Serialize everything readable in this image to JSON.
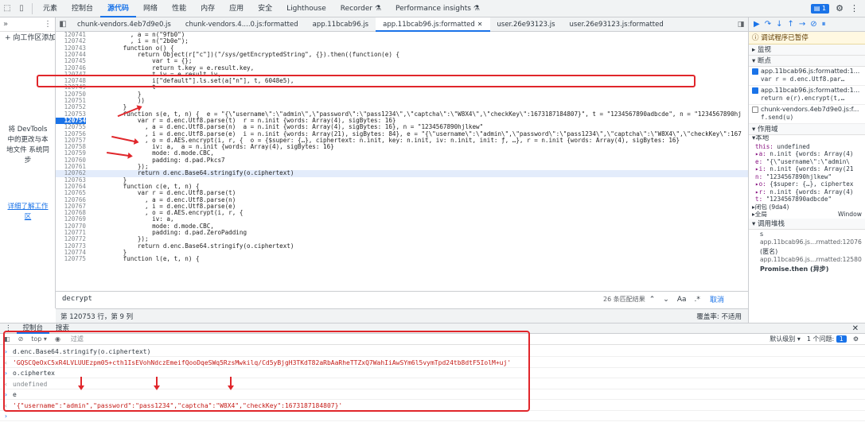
{
  "topbar": {
    "tabs": [
      "元素",
      "控制台",
      "源代码",
      "网络",
      "性能",
      "内存",
      "应用",
      "安全",
      "Lighthouse",
      "Recorder ⚗",
      "Performance insights ⚗"
    ],
    "active_index": 2,
    "issues_badge": "1"
  },
  "navigator": {
    "add_workspace": "+ 向工作区添加",
    "drop_message": "将 DevTools 中的更改与本地文件 系统同步",
    "learn_more": "详细了解工作区"
  },
  "file_tabs": [
    {
      "label": "chunk-vendors.4eb7d9e0.js",
      "active": false
    },
    {
      "label": "chunk-vendors.4....0.js:formatted",
      "active": false
    },
    {
      "label": "app.11bcab96.js",
      "active": false
    },
    {
      "label": "app.11bcab96.js:formatted",
      "active": true
    },
    {
      "label": "user.26e93123.js",
      "active": false
    },
    {
      "label": "user.26e93123.js:formatted",
      "active": false
    }
  ],
  "code": {
    "lines": [
      {
        "n": "120741",
        "t": "          , a = n(\"9fb0\")"
      },
      {
        "n": "120742",
        "t": "          , i = n(\"2b0e\");"
      },
      {
        "n": "120743",
        "t": "        function o() {"
      },
      {
        "n": "120744",
        "t": "            return Object(r[\"c\"])(\"/sys/getEncryptedString\", {}).then((function(e) {"
      },
      {
        "n": "120745",
        "t": "                var t = {};"
      },
      {
        "n": "120746",
        "t": "                return t.key = e.result.key,"
      },
      {
        "n": "120747",
        "t": "                t.iv = e.result.iv,"
      },
      {
        "n": "120748",
        "t": "                i[\"default\"].ls.set(a[\"n\"], t, 6048e5),"
      },
      {
        "n": "120749",
        "t": "                t"
      },
      {
        "n": "120750",
        "t": "            }"
      },
      {
        "n": "120751",
        "t": "            ))"
      },
      {
        "n": "120752",
        "t": "        }"
      },
      {
        "n": "120753",
        "t": "        function s(e, t, n) {  e = \"{\\\"username\\\":\\\"admin\\\",\\\"password\\\":\\\"pass1234\\\",\\\"captcha\\\":\\\"W8X4\\\",\\\"checkKey\\\":1673187184807}\", t = \"1234567890adbcde\", n = \"1234567890hj"
      },
      {
        "n": "120754",
        "t": "            var r = d.enc.Utf8.parse(t)  r = n.init {words: Array(4), sigBytes: 16}"
      },
      {
        "n": "120755",
        "t": "              , a = d.enc.Utf8.parse(n)  a = n.init {words: Array(4), sigBytes: 16}, n = \"1234567890hjlkew\""
      },
      {
        "n": "120756",
        "t": "              , i = d.enc.Utf8.parse(e)  i = n.init {words: Array(21), sigBytes: 84}, e = \"{\\\"username\\\":\\\"admin\\\",\\\"password\\\":\\\"pass1234\\\",\\\"captcha\\\":\\\"W8X4\\\",\\\"checkKey\\\":167"
      },
      {
        "n": "120757",
        "t": "              , o = d.AES.encrypt(i, r, {  o = {$super: {…}, ciphertext: n.init, key: n.init, iv: n.init, init: ƒ, …}, r = n.init {words: Array(4), sigBytes: 16}"
      },
      {
        "n": "120758",
        "t": "                iv: a,  a = n.init {words: Array(4), sigBytes: 16}"
      },
      {
        "n": "120759",
        "t": "                mode: d.mode.CBC,"
      },
      {
        "n": "120760",
        "t": "                padding: d.pad.Pkcs7"
      },
      {
        "n": "120761",
        "t": "            });"
      },
      {
        "n": "120762",
        "t": "            return d.enc.Base64.stringify(o.ciphertext)"
      },
      {
        "n": "120763",
        "t": "        }"
      },
      {
        "n": "120764",
        "t": "        function c(e, t, n) {"
      },
      {
        "n": "120765",
        "t": "            var r = d.enc.Utf8.parse(t)"
      },
      {
        "n": "120766",
        "t": "              , a = d.enc.Utf8.parse(n)"
      },
      {
        "n": "120767",
        "t": "              , i = d.enc.Utf8.parse(e)"
      },
      {
        "n": "120768",
        "t": "              , o = d.AES.encrypt(i, r, {"
      },
      {
        "n": "120769",
        "t": "                iv: a,"
      },
      {
        "n": "120770",
        "t": "                mode: d.mode.CBC,"
      },
      {
        "n": "120771",
        "t": "                padding: d.pad.ZeroPadding"
      },
      {
        "n": "120772",
        "t": "            });"
      },
      {
        "n": "120773",
        "t": "            return d.enc.Base64.stringify(o.ciphertext)"
      },
      {
        "n": "120774",
        "t": "        }"
      },
      {
        "n": "120775",
        "t": "        function l(e, t, n) {"
      }
    ],
    "breakpoint_line": "120754",
    "paused_line": "120762"
  },
  "search": {
    "query": "decrypt",
    "count": "26 条匹配结果",
    "match_case": "Aa",
    "regex": ".*",
    "cancel": "取消"
  },
  "status": {
    "position": "第 120753 行，第 9 列",
    "coverage": "覆盖率: 不适用"
  },
  "sidebar": {
    "paused": "调试程序已暂停",
    "watch": "监视",
    "breakpoints": "断点",
    "bp_items": [
      {
        "file": "app.11bcab96.js:formatted:1...",
        "code": "var r = d.enc.Utf8.par…",
        "checked": true
      },
      {
        "file": "app.11bcab96.js:formatted:1...",
        "code": "return e(r).encrypt(t,…",
        "checked": true
      },
      {
        "file": "chunk-vendors.4eb7d9e0.js:f...",
        "code": "f.send(u)",
        "checked": false
      }
    ],
    "scope": "作用域",
    "local": "本地",
    "scope_lines": [
      {
        "k": "this:",
        "v": " undefined"
      },
      {
        "k": "▸a:",
        "v": " n.init {words: Array(4)"
      },
      {
        "k": "  e:",
        "v": " \"{\\\"username\\\":\\\"admin\\"
      },
      {
        "k": "▸i:",
        "v": " n.init {words: Array(21"
      },
      {
        "k": "  n:",
        "v": " \"1234567890hjlkew\""
      },
      {
        "k": "▸o:",
        "v": " {$super: {…}, ciphertex"
      },
      {
        "k": "▸r:",
        "v": " n.init {words: Array(4)"
      },
      {
        "k": "  t:",
        "v": " \"1234567890adbcde\""
      }
    ],
    "closure": "▸闭包 (9da4)",
    "global": "▸全局",
    "global_value": "Window",
    "callstack": "调用堆栈",
    "stack": [
      {
        "fn": "s",
        "loc": "app.11bcab96.js…rmatted:12076"
      },
      {
        "fn": "(匿名)",
        "loc": "app.11bcab96.js…rmatted:12580"
      },
      {
        "fn": "Promise.then (异步)",
        "loc": ""
      }
    ]
  },
  "drawer": {
    "tabs": [
      "控制台",
      "搜索"
    ],
    "toolbar_top": "top ▾",
    "toolbar_filter": "过滤",
    "levels": "默认级别 ▾",
    "issues": "1 个问题:",
    "issues_count": "1"
  },
  "console": {
    "rows": [
      {
        "kind": "in",
        "text": "d.enc.Base64.stringify(o.ciphertext)"
      },
      {
        "kind": "out-str",
        "text": "'GQSCQeOxC5xR4LVLUUEzpm05+cth1IsEVohNdczEmeifQooDqeSWq5RzsMwkilq/Cd5yBjgH3TKdT82aRbAaRheTTZxQ7WahIiAwSYm6l5vymTpd24tb8dtF5IolM+uj'"
      },
      {
        "kind": "in",
        "text": "o.ciphertex"
      },
      {
        "kind": "out-undef",
        "text": "undefined"
      },
      {
        "kind": "in",
        "text": "e"
      },
      {
        "kind": "out-str",
        "text": "'{\"username\":\"admin\",\"password\":\"pass1234\",\"captcha\":\"W8X4\",\"checkKey\":1673187184807}'"
      },
      {
        "kind": "in",
        "text": ""
      }
    ]
  }
}
